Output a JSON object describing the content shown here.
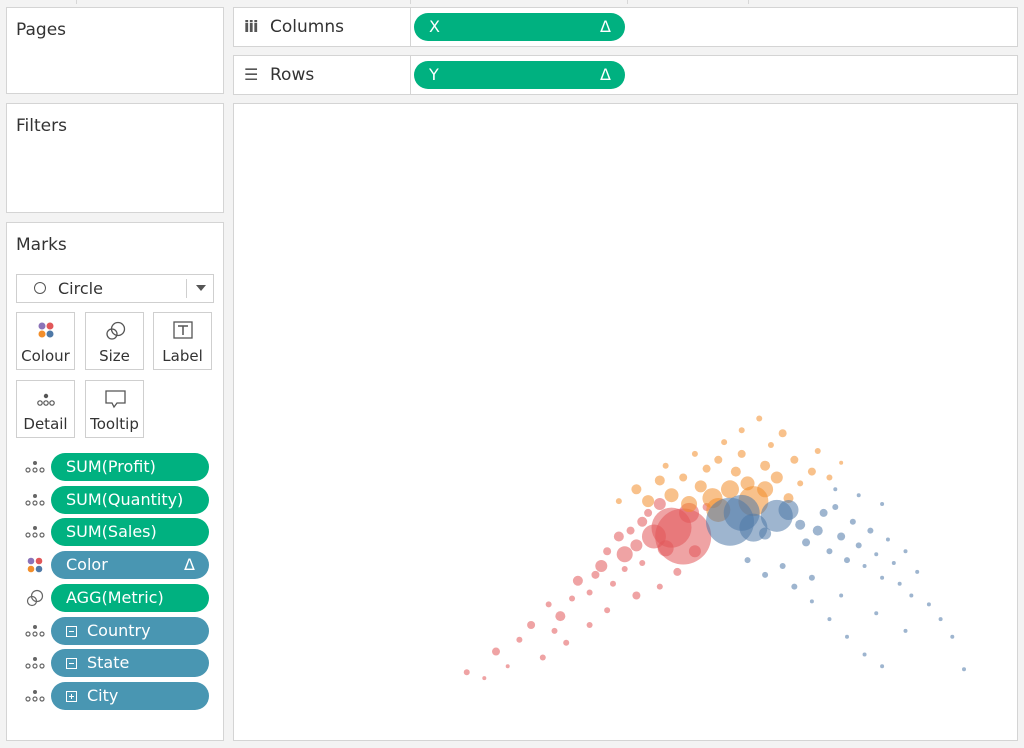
{
  "pages": {
    "title": "Pages"
  },
  "filters": {
    "title": "Filters"
  },
  "shelves": {
    "columns": {
      "label": "Columns",
      "pill": "X",
      "pill_suffix": "Δ"
    },
    "rows": {
      "label": "Rows",
      "pill": "Y",
      "pill_suffix": "Δ"
    }
  },
  "marks": {
    "title": "Marks",
    "type": "Circle",
    "buttons": {
      "colour": "Colour",
      "size": "Size",
      "label": "Label",
      "detail": "Detail",
      "tooltip": "Tooltip"
    },
    "fields": [
      {
        "label": "SUM(Profit)",
        "color": "green",
        "icon": "detail-icon"
      },
      {
        "label": "SUM(Quantity)",
        "color": "green",
        "icon": "detail-icon"
      },
      {
        "label": "SUM(Sales)",
        "color": "green",
        "icon": "detail-icon"
      },
      {
        "label": "Color",
        "color": "blue",
        "icon": "colour-icon",
        "suffix": "Δ"
      },
      {
        "label": "AGG(Metric)",
        "color": "green",
        "icon": "size-icon"
      },
      {
        "label": "Country",
        "color": "blue",
        "icon": "detail-icon",
        "hier": "minus"
      },
      {
        "label": "State",
        "color": "blue",
        "icon": "detail-icon",
        "hier": "minus"
      },
      {
        "label": "City",
        "color": "blue",
        "icon": "detail-icon",
        "hier": "plus"
      }
    ]
  },
  "colors": {
    "green": "#00b180",
    "blue": "#4996b2",
    "red": "#e15759",
    "orange": "#f28e2b",
    "steel": "#4e79a7"
  },
  "chart_data": {
    "type": "scatter",
    "title": "",
    "xlabel": "",
    "ylabel": "",
    "grid": false,
    "note": "sized scatter, three colour groups",
    "series": [
      {
        "color": "#e15759",
        "points": [
          [
            0.15,
            0.04,
            3
          ],
          [
            0.2,
            0.11,
            4
          ],
          [
            0.24,
            0.15,
            3
          ],
          [
            0.26,
            0.2,
            4
          ],
          [
            0.29,
            0.27,
            3
          ],
          [
            0.31,
            0.23,
            5
          ],
          [
            0.33,
            0.29,
            3
          ],
          [
            0.34,
            0.35,
            5
          ],
          [
            0.36,
            0.31,
            3
          ],
          [
            0.37,
            0.37,
            4
          ],
          [
            0.38,
            0.4,
            6
          ],
          [
            0.39,
            0.45,
            4
          ],
          [
            0.4,
            0.34,
            3
          ],
          [
            0.41,
            0.5,
            5
          ],
          [
            0.42,
            0.44,
            8
          ],
          [
            0.43,
            0.52,
            4
          ],
          [
            0.44,
            0.47,
            6
          ],
          [
            0.45,
            0.41,
            3
          ],
          [
            0.45,
            0.55,
            5
          ],
          [
            0.46,
            0.58,
            4
          ],
          [
            0.47,
            0.5,
            12
          ],
          [
            0.48,
            0.61,
            6
          ],
          [
            0.49,
            0.46,
            8
          ],
          [
            0.5,
            0.53,
            20
          ],
          [
            0.52,
            0.5,
            28
          ],
          [
            0.53,
            0.58,
            10
          ],
          [
            0.54,
            0.45,
            6
          ],
          [
            0.51,
            0.38,
            4
          ],
          [
            0.48,
            0.33,
            3
          ],
          [
            0.44,
            0.3,
            4
          ],
          [
            0.39,
            0.25,
            3
          ],
          [
            0.36,
            0.2,
            3
          ],
          [
            0.32,
            0.14,
            3
          ],
          [
            0.28,
            0.09,
            3
          ],
          [
            0.22,
            0.06,
            2
          ],
          [
            0.18,
            0.02,
            2
          ],
          [
            0.3,
            0.18,
            3
          ],
          [
            0.42,
            0.39,
            3
          ],
          [
            0.56,
            0.6,
            4
          ]
        ]
      },
      {
        "color": "#f28e2b",
        "points": [
          [
            0.41,
            0.62,
            3
          ],
          [
            0.44,
            0.66,
            5
          ],
          [
            0.46,
            0.62,
            6
          ],
          [
            0.48,
            0.69,
            5
          ],
          [
            0.5,
            0.64,
            7
          ],
          [
            0.52,
            0.7,
            4
          ],
          [
            0.53,
            0.61,
            8
          ],
          [
            0.55,
            0.67,
            6
          ],
          [
            0.56,
            0.73,
            4
          ],
          [
            0.57,
            0.63,
            10
          ],
          [
            0.58,
            0.59,
            12
          ],
          [
            0.6,
            0.66,
            9
          ],
          [
            0.61,
            0.72,
            5
          ],
          [
            0.62,
            0.78,
            4
          ],
          [
            0.63,
            0.68,
            7
          ],
          [
            0.64,
            0.62,
            15
          ],
          [
            0.66,
            0.74,
            5
          ],
          [
            0.67,
            0.81,
            3
          ],
          [
            0.68,
            0.7,
            6
          ],
          [
            0.69,
            0.85,
            4
          ],
          [
            0.7,
            0.63,
            5
          ],
          [
            0.71,
            0.76,
            4
          ],
          [
            0.72,
            0.68,
            3
          ],
          [
            0.74,
            0.72,
            4
          ],
          [
            0.75,
            0.79,
            3
          ],
          [
            0.77,
            0.7,
            3
          ],
          [
            0.79,
            0.75,
            2
          ],
          [
            0.54,
            0.78,
            3
          ],
          [
            0.59,
            0.82,
            3
          ],
          [
            0.65,
            0.9,
            3
          ],
          [
            0.62,
            0.86,
            3
          ],
          [
            0.49,
            0.74,
            3
          ],
          [
            0.58,
            0.76,
            4
          ],
          [
            0.66,
            0.66,
            8
          ]
        ]
      },
      {
        "color": "#4e79a7",
        "points": [
          [
            0.6,
            0.55,
            24
          ],
          [
            0.62,
            0.58,
            18
          ],
          [
            0.64,
            0.53,
            14
          ],
          [
            0.68,
            0.57,
            16
          ],
          [
            0.7,
            0.59,
            10
          ],
          [
            0.66,
            0.51,
            6
          ],
          [
            0.72,
            0.54,
            5
          ],
          [
            0.73,
            0.48,
            4
          ],
          [
            0.75,
            0.52,
            5
          ],
          [
            0.76,
            0.58,
            4
          ],
          [
            0.77,
            0.45,
            3
          ],
          [
            0.78,
            0.6,
            3
          ],
          [
            0.79,
            0.5,
            4
          ],
          [
            0.8,
            0.42,
            3
          ],
          [
            0.81,
            0.55,
            3
          ],
          [
            0.82,
            0.47,
            3
          ],
          [
            0.83,
            0.4,
            2
          ],
          [
            0.84,
            0.52,
            3
          ],
          [
            0.85,
            0.44,
            2
          ],
          [
            0.86,
            0.36,
            2
          ],
          [
            0.87,
            0.49,
            2
          ],
          [
            0.88,
            0.41,
            2
          ],
          [
            0.89,
            0.34,
            2
          ],
          [
            0.9,
            0.45,
            2
          ],
          [
            0.91,
            0.3,
            2
          ],
          [
            0.92,
            0.38,
            2
          ],
          [
            0.94,
            0.27,
            2
          ],
          [
            0.96,
            0.22,
            2
          ],
          [
            0.98,
            0.16,
            2
          ],
          [
            1.0,
            0.05,
            2
          ],
          [
            0.69,
            0.4,
            3
          ],
          [
            0.71,
            0.33,
            3
          ],
          [
            0.74,
            0.28,
            2
          ],
          [
            0.77,
            0.22,
            2
          ],
          [
            0.8,
            0.16,
            2
          ],
          [
            0.83,
            0.1,
            2
          ],
          [
            0.86,
            0.06,
            2
          ],
          [
            0.63,
            0.42,
            3
          ],
          [
            0.66,
            0.37,
            3
          ],
          [
            0.74,
            0.36,
            3
          ],
          [
            0.79,
            0.3,
            2
          ],
          [
            0.85,
            0.24,
            2
          ],
          [
            0.9,
            0.18,
            2
          ],
          [
            0.78,
            0.66,
            2
          ],
          [
            0.82,
            0.64,
            2
          ],
          [
            0.86,
            0.61,
            2
          ]
        ]
      }
    ]
  }
}
